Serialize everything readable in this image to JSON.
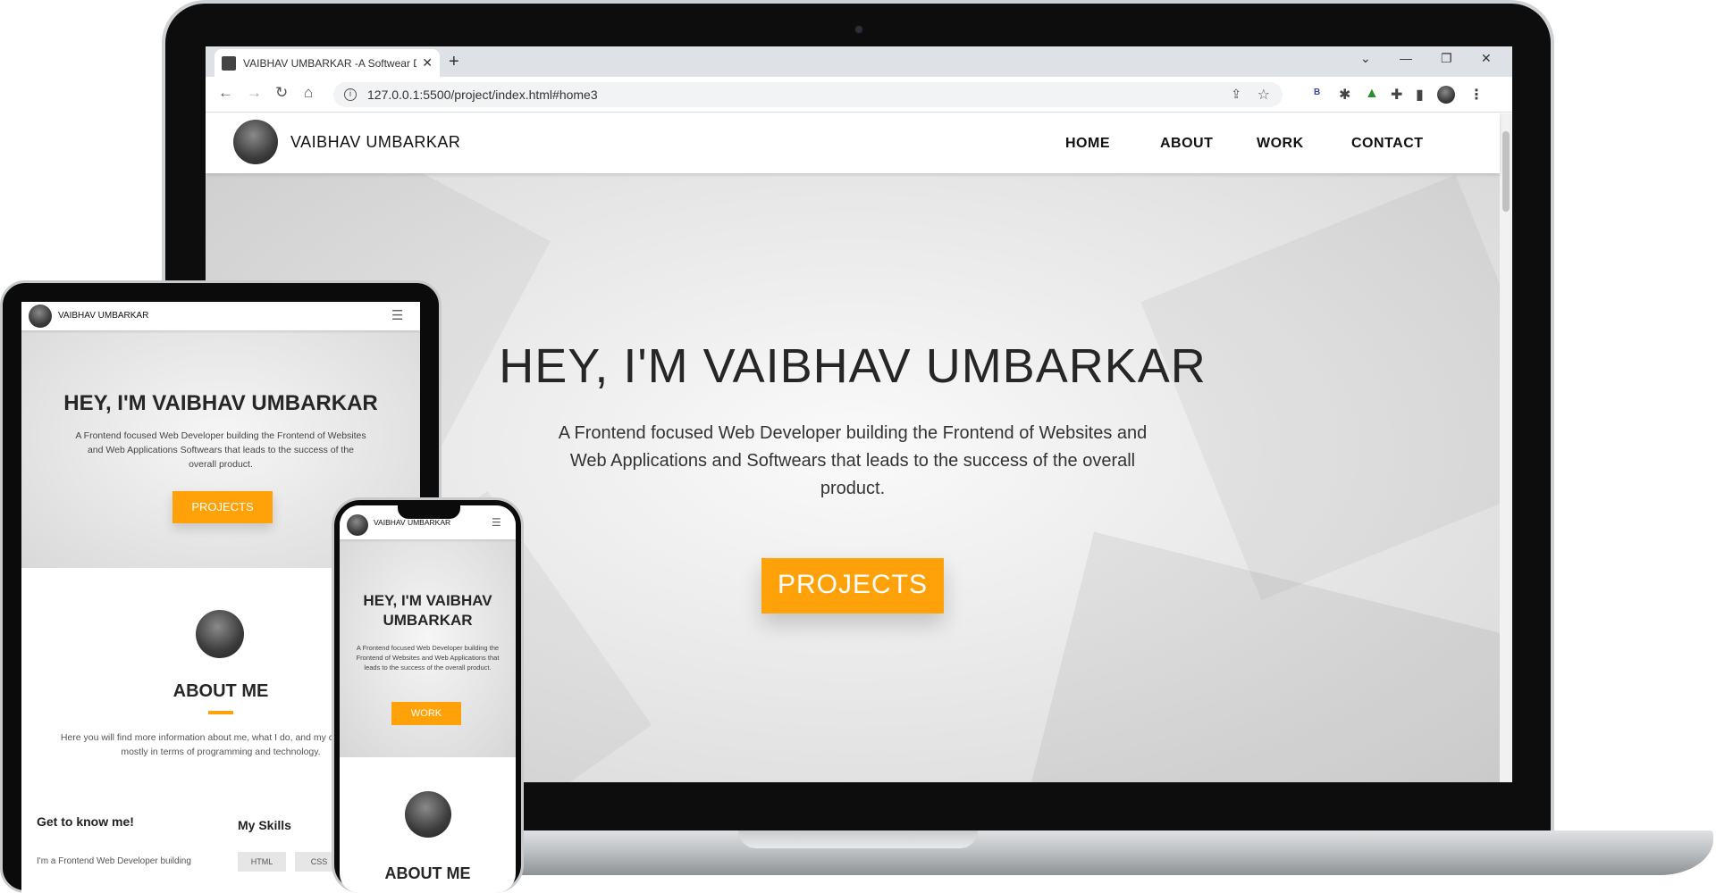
{
  "browser": {
    "tab_title": "VAIBHAV UMBARKAR -A Softwear D",
    "tab_close": "✕",
    "new_tab": "+",
    "window_controls": {
      "dropdown": "⌄",
      "minimize": "—",
      "restore": "❐",
      "close": "✕"
    },
    "url": "127.0.0.1:5500/project/index.html#home3",
    "nav_icons": {
      "back": "←",
      "forward": "→",
      "reload": "↻",
      "home": "⌂"
    }
  },
  "desktop_site": {
    "brand": "VAIBHAV UMBARKAR",
    "nav": [
      "HOME",
      "ABOUT",
      "WORK",
      "CONTACT"
    ],
    "hero_title": "HEY, I'M VAIBHAV UMBARKAR",
    "hero_desc": "A Frontend focused Web Developer building the Frontend of Websites and Web Applications and Softwears that leads to the success of the overall product.",
    "hero_button": "PROJECTS"
  },
  "tablet_site": {
    "brand": "VAIBHAV UMBARKAR",
    "hero_title": "HEY, I'M VAIBHAV UMBARKAR",
    "hero_desc": "A Frontend focused Web Developer building the Frontend of Websites and Web Applications Softwears that leads to the success of the overall product.",
    "hero_button": "PROJECTS",
    "about_title": "ABOUT ME",
    "about_desc": "Here you will find more information about me, what I do, and my current skills mostly in terms of programming and technology.",
    "know_me_title": "Get to know me!",
    "know_me_text": "I'm a Frontend Web Developer building",
    "skills_title": "My Skills",
    "skills": [
      "HTML",
      "CSS"
    ]
  },
  "phone_site": {
    "brand": "VAIBHAV UMBARKAR",
    "hero_title": "HEY, I'M VAIBHAV UMBARKAR",
    "hero_desc": "A Frontend focused Web Developer building the Frontend of Websites and Web Applications that leads to the success of the overall product.",
    "hero_button": "WORK",
    "about_title": "ABOUT ME"
  },
  "colors": {
    "accent": "#ffa20a",
    "text": "#262626"
  }
}
